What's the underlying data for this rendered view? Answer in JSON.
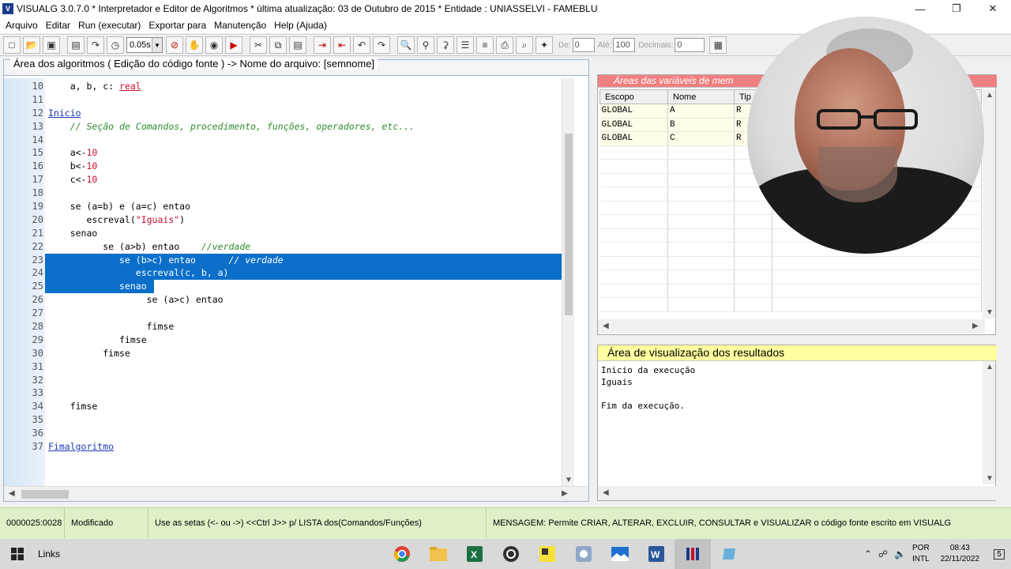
{
  "window": {
    "title": "VISUALG 3.0.7.0 * Interpretador e Editor de Algoritmos * última atualização: 03 de Outubro de 2015 * Entidade : UNIASSELVI - FAMEBLU",
    "app_icon": "visualg-icon"
  },
  "menu": [
    "Arquivo",
    "Editar",
    "Run (executar)",
    "Exportar para",
    "Manutenção",
    "Help (Ajuda)"
  ],
  "toolbar": {
    "speed": "0.05s",
    "de_label": "De:",
    "de_value": "0",
    "ate_label": "Até:",
    "ate_value": "100",
    "decimais_label": "Decimais:",
    "decimais_value": "0"
  },
  "editor": {
    "title": "Área dos algoritmos ( Edição do código fonte ) -> Nome do arquivo: [semnome]",
    "lines": [
      {
        "n": "10",
        "html": "    a, b, c: <span class='kw-red' style='text-decoration:underline'>real</span>"
      },
      {
        "n": "11",
        "html": ""
      },
      {
        "n": "12",
        "html": "<span class='kw-link'>Inicio</span>"
      },
      {
        "n": "13",
        "html": "    <span class='kw-green'>// Seção de Comandos, procedimento, funções, operadores, etc...</span>"
      },
      {
        "n": "14",
        "html": ""
      },
      {
        "n": "15",
        "html": "    a&lt;-<span class='kw-red'>10</span>"
      },
      {
        "n": "16",
        "html": "    b&lt;-<span class='kw-red'>10</span>"
      },
      {
        "n": "17",
        "html": "    c&lt;-<span class='kw-red'>10</span>"
      },
      {
        "n": "18",
        "html": ""
      },
      {
        "n": "19",
        "html": "    se (a=b) e (a=c) entao"
      },
      {
        "n": "20",
        "html": "       escreval(<span class='kw-red'>\"Iguais\"</span>)"
      },
      {
        "n": "21",
        "html": "    senao"
      },
      {
        "n": "22",
        "html": "          se (a&gt;b) entao    <span class='kw-green'>//verdade</span>"
      },
      {
        "n": "23",
        "html": "             se (b&gt;c) entao      <span style='font-style:italic'>// verdade</span>",
        "sel": "full"
      },
      {
        "n": "24",
        "html": "                escreval(c, b, a)",
        "sel": "full"
      },
      {
        "n": "25",
        "html": "             senao",
        "sel": "partial"
      },
      {
        "n": "26",
        "html": "                  se (a&gt;c) entao"
      },
      {
        "n": "27",
        "html": ""
      },
      {
        "n": "28",
        "html": "                  fimse"
      },
      {
        "n": "29",
        "html": "             fimse"
      },
      {
        "n": "30",
        "html": "          fimse"
      },
      {
        "n": "31",
        "html": ""
      },
      {
        "n": "32",
        "html": ""
      },
      {
        "n": "33",
        "html": ""
      },
      {
        "n": "34",
        "html": "    fimse"
      },
      {
        "n": "35",
        "html": ""
      },
      {
        "n": "36",
        "html": ""
      },
      {
        "n": "37",
        "html": "<span class='kw-link'>Fimalgoritmo</span>"
      }
    ]
  },
  "variables": {
    "title": "Áreas das variáveis de mem",
    "columns": [
      "Escopo",
      "Nome",
      "Tip"
    ],
    "rows": [
      [
        "GLOBAL",
        "A",
        "R"
      ],
      [
        "GLOBAL",
        "B",
        "R"
      ],
      [
        "GLOBAL",
        "C",
        "R"
      ]
    ]
  },
  "output": {
    "title": "Área de visualização dos resultados",
    "text": "Inicio da execução\nIguais\n\nFim da execução."
  },
  "status": {
    "position": "0000025:0028",
    "state": "Modificado",
    "hint": "Use as setas (<- ou ->) <<Ctrl J>> p/ LISTA dos(Comandos/Funções)",
    "message": "MENSAGEM: Permite CRIAR, ALTERAR, EXCLUIR, CONSULTAR e VISUALIZAR o código fonte escrito em VISUALG"
  },
  "taskbar": {
    "links": "Links",
    "lang1": "POR",
    "lang2": "INTL",
    "time": "08:43",
    "date": "22/11/2022",
    "notifications": "5"
  }
}
